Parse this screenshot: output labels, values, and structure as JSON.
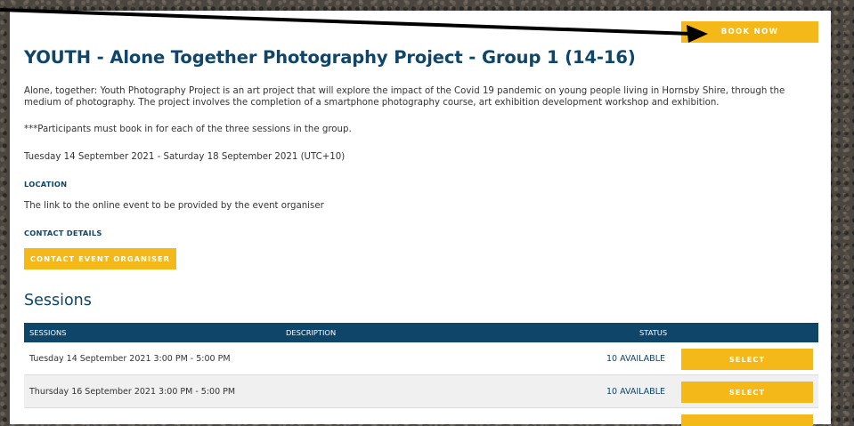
{
  "header": {
    "book_now_label": "BOOK NOW",
    "title": "YOUTH - Alone Together Photography Project - Group 1 (14-16)"
  },
  "event": {
    "description": "Alone, together: Youth Photography Project is an art project that will explore the impact of the Covid 19 pandemic on young people living in Hornsby Shire, through the medium of photography. The project involves the completion of a smartphone photography course, art exhibition development workshop and exhibition.",
    "note": "***Participants must book in for each of the three sessions in the group.",
    "dates": "Tuesday 14 September 2021 - Saturday 18 September 2021 (UTC+10)",
    "location_label": "LOCATION",
    "location_text": "The link to the online event to be provided by the event organiser",
    "contact_label": "CONTACT DETAILS",
    "contact_button": "CONTACT EVENT ORGANISER"
  },
  "sessions": {
    "heading": "Sessions",
    "columns": [
      "SESSIONS",
      "DESCRIPTION",
      "STATUS"
    ],
    "rows": [
      {
        "when": "Tuesday 14 September 2021 3:00 PM - 5:00 PM",
        "status": "10 AVAILABLE",
        "action": "SELECT"
      },
      {
        "when": "Thursday 16 September 2021 3:00 PM - 5:00 PM",
        "status": "10 AVAILABLE",
        "action": "SELECT"
      }
    ]
  },
  "colors": {
    "navy": "#0e4569",
    "accent": "#f5b819"
  }
}
